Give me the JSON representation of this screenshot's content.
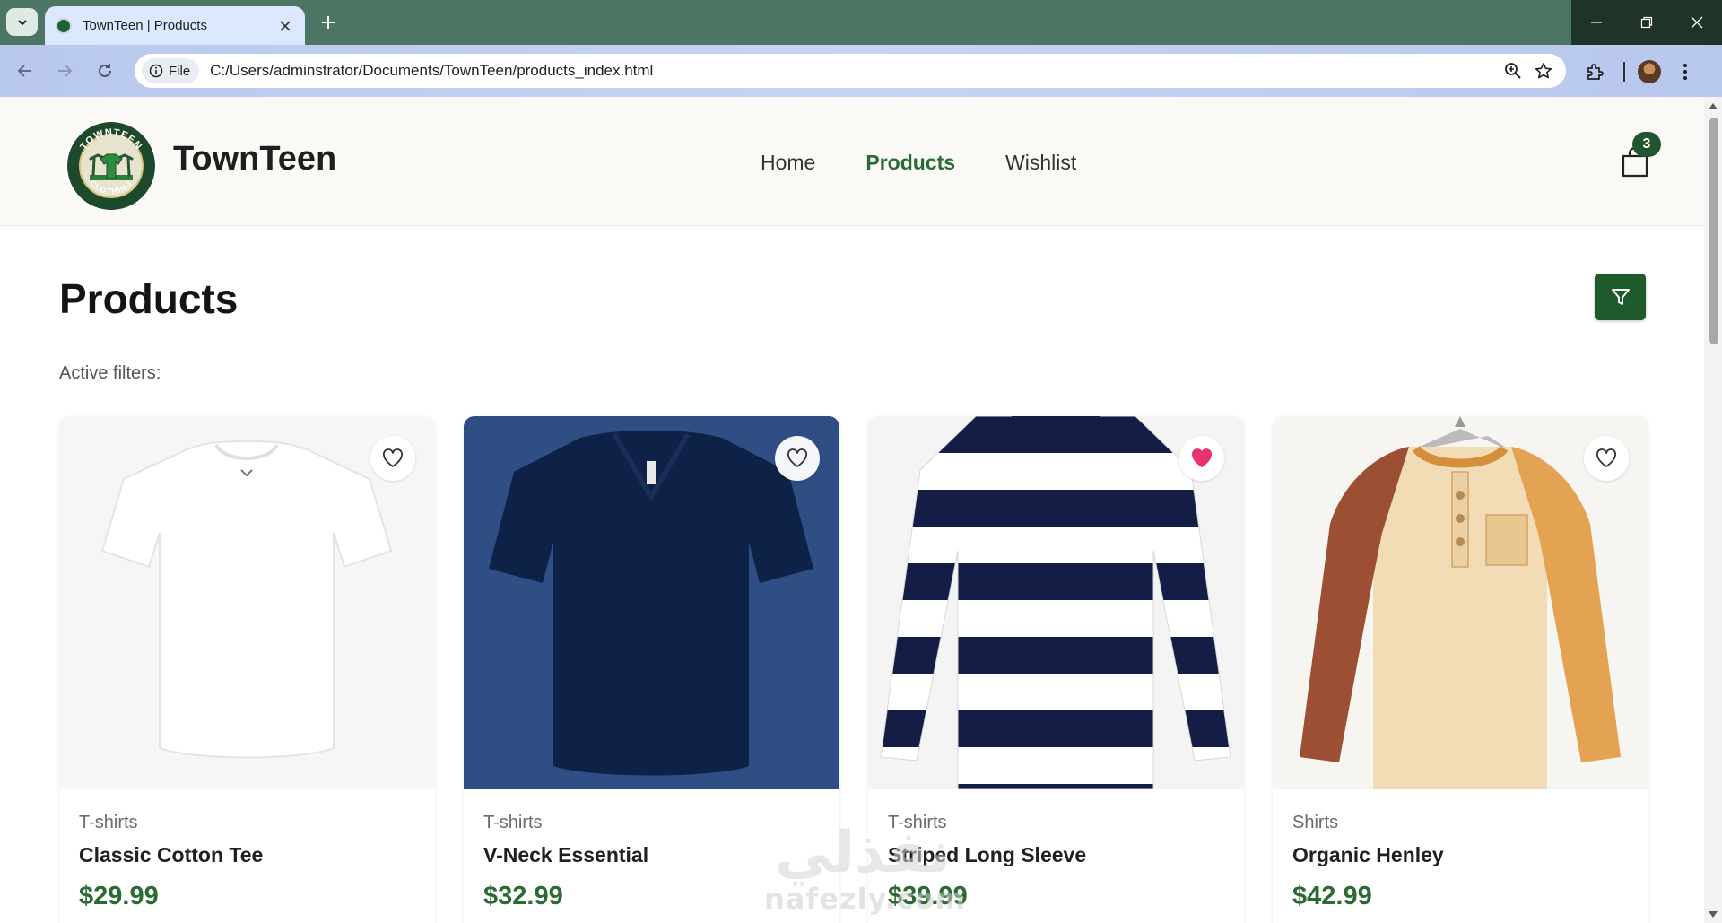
{
  "browser": {
    "tab_title": "TownTeen | Products",
    "file_chip": "File",
    "url": "C:/Users/adminstrator/Documents/TownTeen/products_index.html"
  },
  "site": {
    "brand": "TownTeen",
    "logo_top_text": "TOWNTEEN",
    "logo_bottom_text": "CLOTHING",
    "nav": [
      {
        "label": "Home",
        "active": false
      },
      {
        "label": "Products",
        "active": true
      },
      {
        "label": "Wishlist",
        "active": false
      }
    ],
    "cart_count": "3"
  },
  "page": {
    "title": "Products",
    "active_filters_label": "Active filters:"
  },
  "products": [
    {
      "category": "T-shirts",
      "name": "Classic Cotton Tee",
      "price": "$29.99",
      "wishlisted": false,
      "image": "white-crew-tee"
    },
    {
      "category": "T-shirts",
      "name": "V-Neck Essential",
      "price": "$32.99",
      "wishlisted": false,
      "image": "navy-vneck-tee"
    },
    {
      "category": "T-shirts",
      "name": "Striped Long Sleeve",
      "price": "$39.99",
      "wishlisted": true,
      "image": "navy-white-striped-longsleeve"
    },
    {
      "category": "Shirts",
      "name": "Organic Henley",
      "price": "$42.99",
      "wishlisted": false,
      "image": "tan-raglan-henley"
    }
  ],
  "watermark": {
    "top": "نفذلي",
    "bottom": "nafezly.com"
  },
  "colors": {
    "brand_green": "#2a6a34",
    "filter_button": "#1f5a2d",
    "wishlist_active": "#e8336f"
  }
}
